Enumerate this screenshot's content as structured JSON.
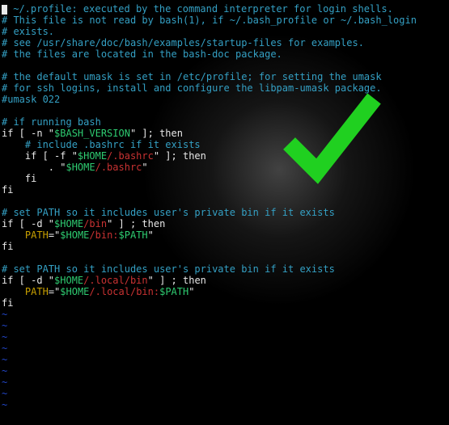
{
  "file": "~/.profile",
  "colors": {
    "background": "#000000",
    "comment": "#34a0c4",
    "string": "#c93232",
    "variable": "#2ecc71",
    "keyword": "#c8a000",
    "text": "#e8e8e8",
    "tilde": "#2246c9",
    "checkmark": "#20d020"
  },
  "overlay": {
    "icon": "checkmark",
    "present": true
  },
  "cursor": {
    "line": 0,
    "col": 0
  },
  "lines": [
    {
      "t": "comment",
      "v": "# ~/.profile: executed by the command interpreter for login shells."
    },
    {
      "t": "comment",
      "v": "# This file is not read by bash(1), if ~/.bash_profile or ~/.bash_login"
    },
    {
      "t": "comment",
      "v": "# exists."
    },
    {
      "t": "comment",
      "v": "# see /usr/share/doc/bash/examples/startup-files for examples."
    },
    {
      "t": "comment",
      "v": "# the files are located in the bash-doc package."
    },
    {
      "t": "blank",
      "v": ""
    },
    {
      "t": "comment",
      "v": "# the default umask is set in /etc/profile; for setting the umask"
    },
    {
      "t": "comment",
      "v": "# for ssh logins, install and configure the libpam-umask package."
    },
    {
      "t": "comment",
      "v": "#umask 022"
    },
    {
      "t": "blank",
      "v": ""
    },
    {
      "t": "comment",
      "v": "# if running bash"
    },
    {
      "t": "code",
      "seg": [
        {
          "c": "plain",
          "v": "if [ -n \""
        },
        {
          "c": "var",
          "v": "$BASH_VERSION"
        },
        {
          "c": "plain",
          "v": "\" ]; then"
        }
      ]
    },
    {
      "t": "comment",
      "v": "    # include .bashrc if it exists"
    },
    {
      "t": "code",
      "seg": [
        {
          "c": "plain",
          "v": "    if [ -f \""
        },
        {
          "c": "var",
          "v": "$HOME"
        },
        {
          "c": "str",
          "v": "/.bashrc"
        },
        {
          "c": "plain",
          "v": "\" ]; then"
        }
      ]
    },
    {
      "t": "code",
      "seg": [
        {
          "c": "plain",
          "v": "        . \""
        },
        {
          "c": "var",
          "v": "$HOME"
        },
        {
          "c": "str",
          "v": "/.bashrc"
        },
        {
          "c": "plain",
          "v": "\""
        }
      ]
    },
    {
      "t": "code",
      "seg": [
        {
          "c": "plain",
          "v": "    fi"
        }
      ]
    },
    {
      "t": "code",
      "seg": [
        {
          "c": "plain",
          "v": "fi"
        }
      ]
    },
    {
      "t": "blank",
      "v": ""
    },
    {
      "t": "comment",
      "v": "# set PATH so it includes user's private bin if it exists"
    },
    {
      "t": "code",
      "seg": [
        {
          "c": "plain",
          "v": "if [ -d \""
        },
        {
          "c": "var",
          "v": "$HOME"
        },
        {
          "c": "str",
          "v": "/bin"
        },
        {
          "c": "plain",
          "v": "\" ] ; then"
        }
      ]
    },
    {
      "t": "code",
      "seg": [
        {
          "c": "plain",
          "v": "    "
        },
        {
          "c": "key",
          "v": "PATH"
        },
        {
          "c": "plain",
          "v": "=\""
        },
        {
          "c": "var",
          "v": "$HOME"
        },
        {
          "c": "str",
          "v": "/bin:"
        },
        {
          "c": "var",
          "v": "$PATH"
        },
        {
          "c": "plain",
          "v": "\""
        }
      ]
    },
    {
      "t": "code",
      "seg": [
        {
          "c": "plain",
          "v": "fi"
        }
      ]
    },
    {
      "t": "blank",
      "v": ""
    },
    {
      "t": "comment",
      "v": "# set PATH so it includes user's private bin if it exists"
    },
    {
      "t": "code",
      "seg": [
        {
          "c": "plain",
          "v": "if [ -d \""
        },
        {
          "c": "var",
          "v": "$HOME"
        },
        {
          "c": "str",
          "v": "/.local/bin"
        },
        {
          "c": "plain",
          "v": "\" ] ; then"
        }
      ]
    },
    {
      "t": "code",
      "seg": [
        {
          "c": "plain",
          "v": "    "
        },
        {
          "c": "key",
          "v": "PATH"
        },
        {
          "c": "plain",
          "v": "=\""
        },
        {
          "c": "var",
          "v": "$HOME"
        },
        {
          "c": "str",
          "v": "/.local/bin:"
        },
        {
          "c": "var",
          "v": "$PATH"
        },
        {
          "c": "plain",
          "v": "\""
        }
      ]
    },
    {
      "t": "code",
      "seg": [
        {
          "c": "plain",
          "v": "fi"
        }
      ]
    },
    {
      "t": "tilde",
      "v": "~"
    },
    {
      "t": "tilde",
      "v": "~"
    },
    {
      "t": "tilde",
      "v": "~"
    },
    {
      "t": "tilde",
      "v": "~"
    },
    {
      "t": "tilde",
      "v": "~"
    },
    {
      "t": "tilde",
      "v": "~"
    },
    {
      "t": "tilde",
      "v": "~"
    },
    {
      "t": "tilde",
      "v": "~"
    },
    {
      "t": "tilde",
      "v": "~"
    }
  ]
}
